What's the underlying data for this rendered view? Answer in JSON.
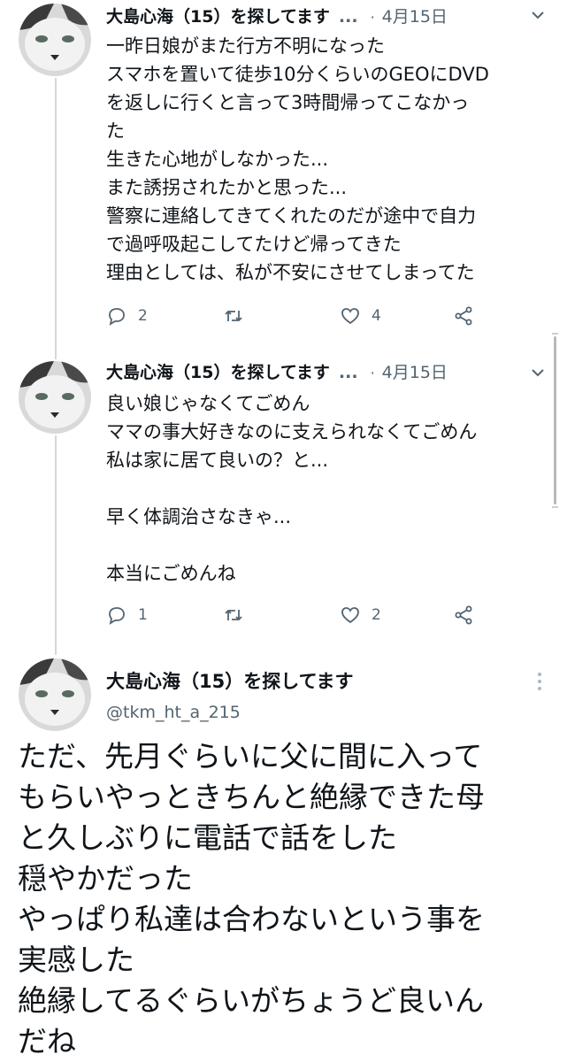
{
  "tweets": [
    {
      "name": "大島心海（15）を探してます",
      "ellipsis": "...",
      "separator": "·",
      "date": "4月15日",
      "lines": [
        "一昨日娘がまた行方不明になった",
        "スマホを置いて徒歩10分くらいのGEOにDVD",
        "を返しに行くと言って3時間帰ってこなかっ",
        "た",
        "生きた心地がしなかった...",
        "また誘拐されたかと思った...",
        "警察に連絡してきてくれたのだが途中で自力",
        "で過呼吸起こしてたけど帰ってきた",
        "理由としては、私が不安にさせてしまってた"
      ],
      "replies": "2",
      "retweets": "",
      "likes": "4"
    },
    {
      "name": "大島心海（15）を探してます",
      "ellipsis": "...",
      "separator": "·",
      "date": "4月15日",
      "lines": [
        "良い娘じゃなくてごめん",
        "ママの事大好きなのに支えられなくてごめん",
        "私は家に居て良いの？と...",
        "",
        "早く体調治さなきゃ...",
        "",
        "本当にごめんね"
      ],
      "replies": "1",
      "retweets": "",
      "likes": "2"
    }
  ],
  "main": {
    "name": "大島心海（15）を探してます",
    "handle": "@tkm_ht_a_215",
    "lines": [
      "ただ、先月ぐらいに父に間に入って",
      "もらいやっときちんと絶縁できた母",
      "と久しぶりに電話で話をした",
      "穏やかだった",
      "やっぱり私達は合わないという事を",
      "実感した",
      "絶縁してるぐらいがちょうど良いん",
      "だね"
    ]
  },
  "colors": {
    "secondary_text": "#536471",
    "thread_line": "#cfd9de",
    "text": "#0f1419"
  },
  "icons": [
    "reply-icon",
    "retweet-icon",
    "like-icon",
    "share-icon",
    "chevron-down-icon",
    "more-vertical-icon"
  ]
}
